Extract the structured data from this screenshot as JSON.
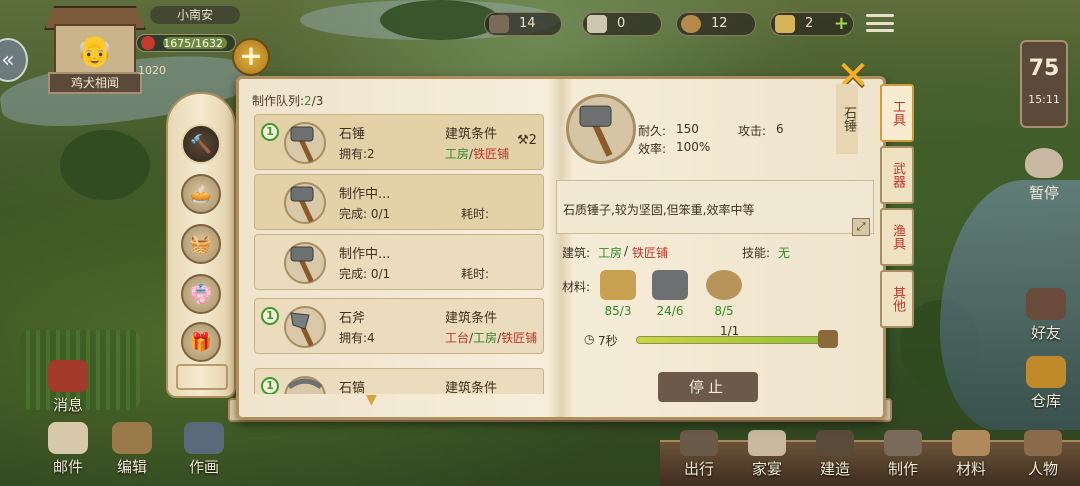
{
  "player": {
    "name": "小南安",
    "title": "鸡犬相闻",
    "stamina": "1675/1632",
    "coins": "1020"
  },
  "resources": [
    {
      "icon": "book-icon",
      "value": "14"
    },
    {
      "icon": "bone-icon",
      "value": "0"
    },
    {
      "icon": "coin-icon",
      "value": "12"
    },
    {
      "icon": "ticket-icon",
      "value": "2"
    }
  ],
  "clock": {
    "day": "75",
    "time": "15:11"
  },
  "right_buttons": {
    "pause": "暂停",
    "friends": "好友",
    "storage": "仓库"
  },
  "left_buttons": {
    "messages": "消息",
    "mail": "邮件",
    "edit": "编辑",
    "paint": "作画"
  },
  "bottom_nav": [
    "出行",
    "家宴",
    "建造",
    "制作",
    "材料",
    "人物"
  ],
  "craft": {
    "queue_label": "制作队列:",
    "queue_used": "2",
    "queue_total": "/3",
    "cards": [
      {
        "badge": "1",
        "name": "石锤",
        "owned": "拥有:2",
        "cond_label": "建筑条件",
        "req_a": "工房",
        "req_sep": "/",
        "req_b": "铁匠铺",
        "count": "2"
      },
      {
        "name": "制作中...",
        "progress": "完成: 0/1",
        "time_label": "耗时:"
      },
      {
        "name": "制作中...",
        "progress": "完成: 0/1",
        "time_label": "耗时:"
      },
      {
        "badge": "1",
        "name": "石斧",
        "owned": "拥有:4",
        "cond_label": "建筑条件",
        "req_a": "工台",
        "req_sep": "/",
        "req_b": "工房",
        "req_sep2": "/",
        "req_c": "铁匠铺"
      },
      {
        "badge": "1",
        "name": "石镐",
        "cond_label": "建筑条件"
      }
    ]
  },
  "detail": {
    "name": "石锤",
    "durability_label": "耐久:",
    "durability": "150",
    "attack_label": "攻击:",
    "attack": "6",
    "efficiency_label": "效率:",
    "efficiency": "100%",
    "description": "石质锤子,较为坚固,但笨重,效率中等",
    "building_label": "建筑:",
    "building_a": "工房",
    "building_sep": "/",
    "building_b": "铁匠铺",
    "skill_label": "技能:",
    "skill": "无",
    "materials_label": "材料:",
    "materials": [
      {
        "icon": "plank-icon",
        "count": "85/3"
      },
      {
        "icon": "stone-icon",
        "count": "24/6"
      },
      {
        "icon": "rope-icon",
        "count": "8/5"
      }
    ],
    "duration": "7秒",
    "progress_text": "1/1",
    "progress": 1.0,
    "stop": "停止"
  },
  "categories": [
    "工具",
    "武器",
    "渔具",
    "其他"
  ],
  "colors": {
    "accent_green": "#2e8a2a",
    "accent_red": "#c2352a",
    "gold": "#f0b22a"
  }
}
